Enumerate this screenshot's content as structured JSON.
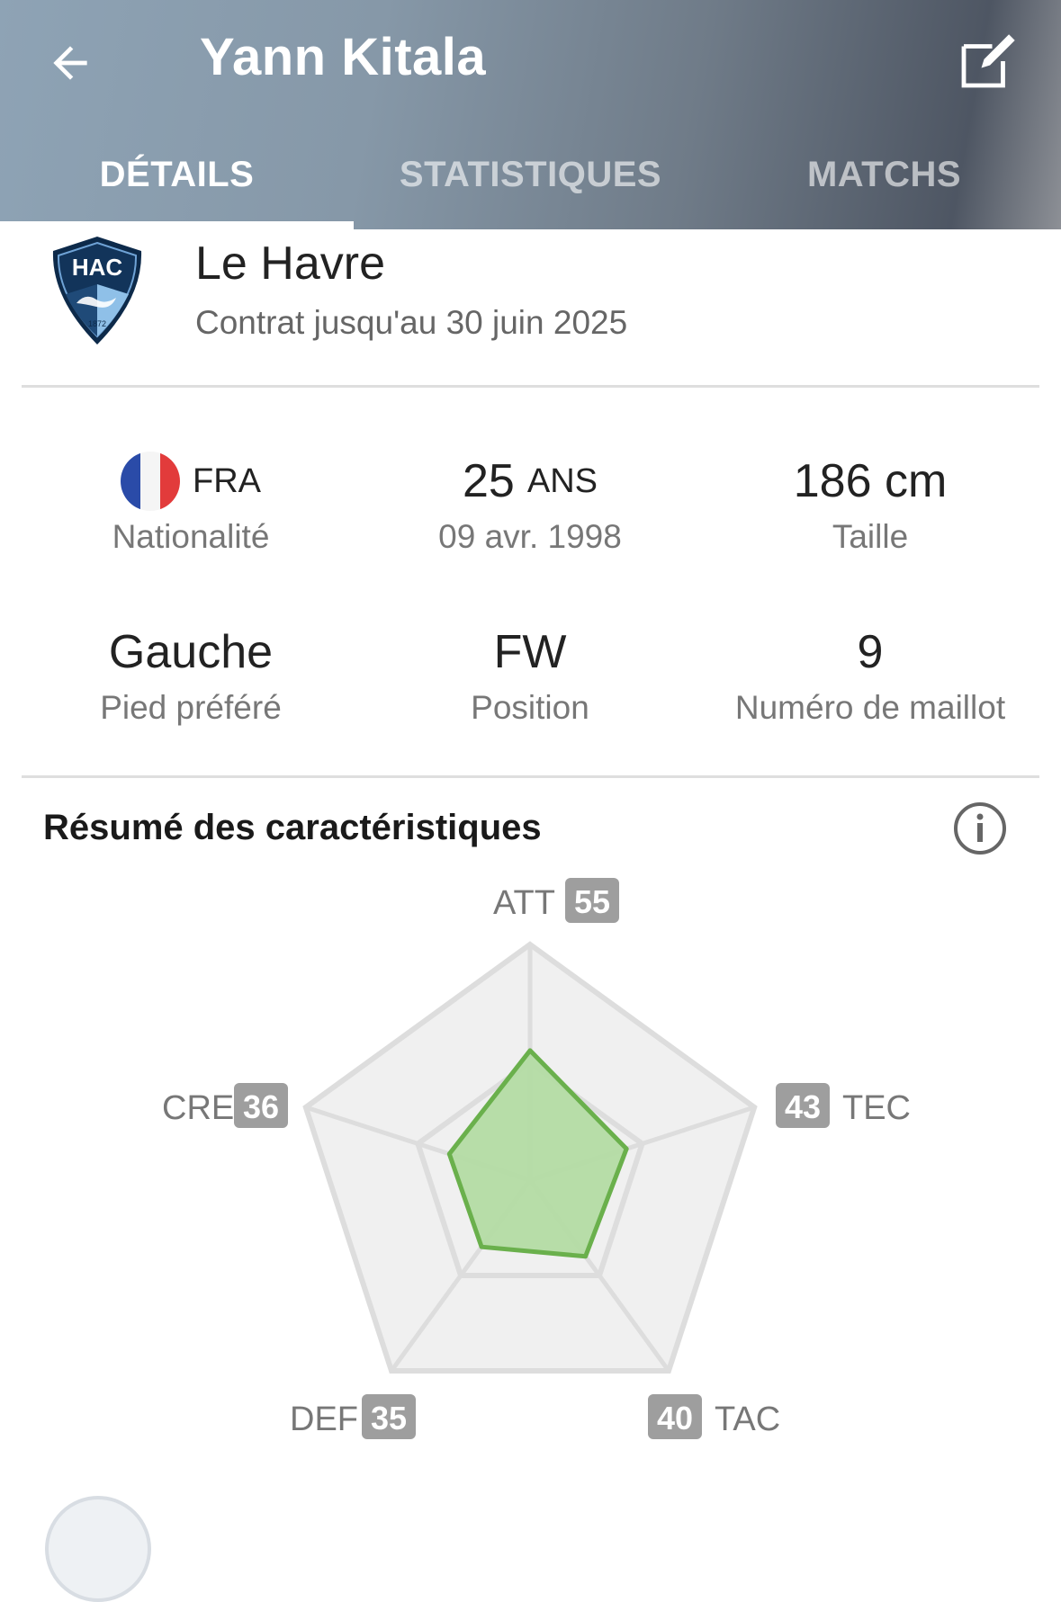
{
  "header": {
    "title": "Yann Kitala",
    "back_icon": "arrow-left-icon",
    "edit_icon": "edit-icon"
  },
  "tabs": [
    {
      "label": "DÉTAILS",
      "active": true
    },
    {
      "label": "STATISTIQUES",
      "active": false
    },
    {
      "label": "MATCHS",
      "active": false
    }
  ],
  "club": {
    "name": "Le Havre",
    "contract": "Contrat jusqu'au 30 juin 2025",
    "logo_text": "HAC",
    "logo_year": "1872"
  },
  "info": {
    "nationality": {
      "value": "FRA",
      "label": "Nationalité"
    },
    "age": {
      "value": "25",
      "unit": "ANS",
      "label": "09 avr. 1998"
    },
    "height": {
      "value": "186 cm",
      "label": "Taille"
    },
    "foot": {
      "value": "Gauche",
      "label": "Pied préféré"
    },
    "position": {
      "value": "FW",
      "label": "Position"
    },
    "shirt": {
      "value": "9",
      "label": "Numéro de maillot"
    }
  },
  "summary": {
    "title": "Résumé des caractéristiques",
    "info_icon": "info-icon"
  },
  "chart_data": {
    "type": "radar",
    "max": 100,
    "axes": [
      {
        "name": "ATT",
        "value": 55
      },
      {
        "name": "TEC",
        "value": 43
      },
      {
        "name": "TAC",
        "value": 40
      },
      {
        "name": "DEF",
        "value": 35
      },
      {
        "name": "CRE",
        "value": 36
      }
    ],
    "colors": {
      "fill": "#b3dba3",
      "stroke": "#6ab04c",
      "grid": "#dddddd",
      "bg": "#f0f0f0",
      "badge": "#9e9e9e"
    }
  }
}
